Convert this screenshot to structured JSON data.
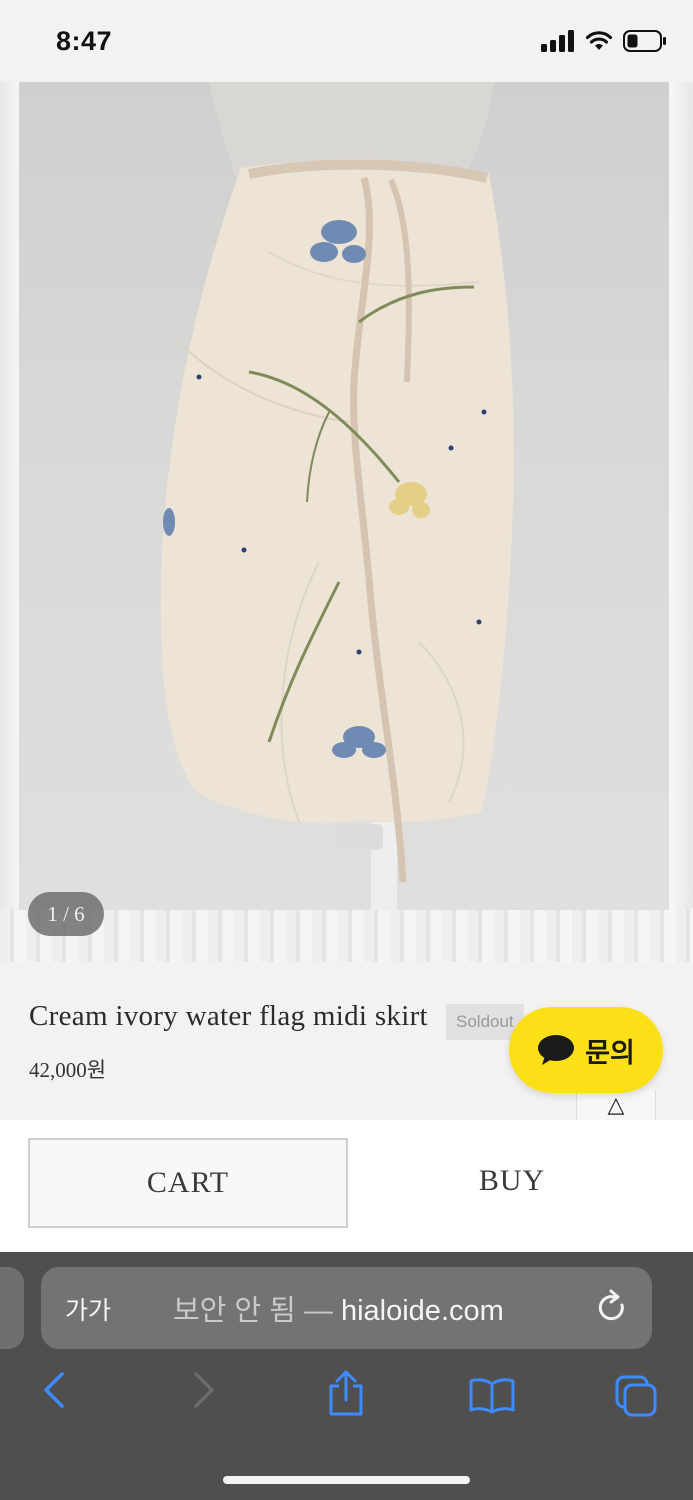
{
  "status_bar": {
    "time": "8:47"
  },
  "gallery": {
    "counter": "1 / 6"
  },
  "product": {
    "name": "Cream ivory water flag midi skirt",
    "badge": "Soldout",
    "price": "42,000원"
  },
  "floating": {
    "inquiry_label": "문의",
    "inquiry_color": "#fbe017",
    "top_arrow": "△"
  },
  "actions": {
    "cart_label": "CART",
    "buy_label": "BUY"
  },
  "browser": {
    "text_size_label": "가가",
    "insecure_label": "보안 안 됨",
    "separator": " — ",
    "host": "hialoide.com",
    "accent": "#3d8bff"
  },
  "icons": [
    "signal-icon",
    "wifi-icon",
    "battery-icon",
    "chat-bubble-icon",
    "reload-icon",
    "back-icon",
    "forward-icon",
    "share-icon",
    "bookmarks-icon",
    "tabs-icon"
  ]
}
